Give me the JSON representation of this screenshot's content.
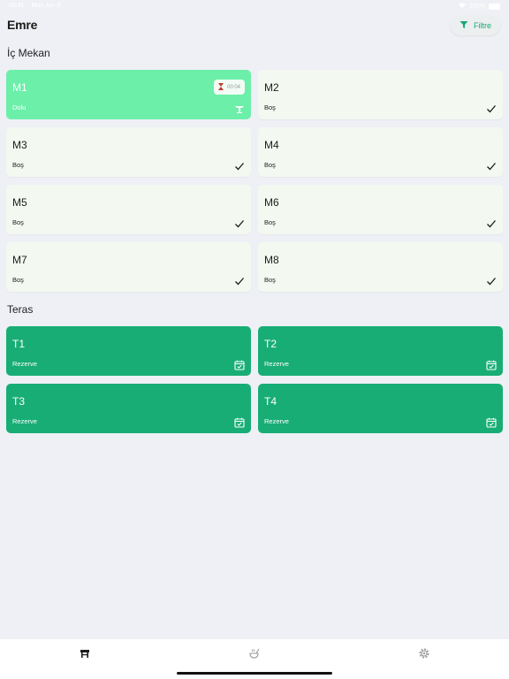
{
  "status_bar": {
    "time": "09:41",
    "date": "Mon Jun 3",
    "battery": "100%"
  },
  "header": {
    "title": "Emre",
    "filter_label": "Filtre"
  },
  "sections": {
    "indoor": {
      "title": "İç Mekan",
      "tables": [
        {
          "name": "M1",
          "status": "Dolu",
          "timer": "00:04"
        },
        {
          "name": "M2",
          "status": "Boş"
        },
        {
          "name": "M3",
          "status": "Boş"
        },
        {
          "name": "M4",
          "status": "Boş"
        },
        {
          "name": "M5",
          "status": "Boş"
        },
        {
          "name": "M6",
          "status": "Boş"
        },
        {
          "name": "M7",
          "status": "Boş"
        },
        {
          "name": "M8",
          "status": "Boş"
        }
      ]
    },
    "terrace": {
      "title": "Teras",
      "tables": [
        {
          "name": "T1",
          "status": "Rezerve"
        },
        {
          "name": "T2",
          "status": "Rezerve"
        },
        {
          "name": "T3",
          "status": "Rezerve"
        },
        {
          "name": "T4",
          "status": "Rezerve"
        }
      ]
    }
  },
  "tabs": [
    {
      "icon": "table-icon",
      "active": true
    },
    {
      "icon": "kitchen-icon",
      "active": false
    },
    {
      "icon": "settings-icon",
      "active": false
    }
  ],
  "colors": {
    "accent": "#18a874",
    "occupied": "#6cefa9",
    "reserved": "#19ad76",
    "empty": "#f3f9f1",
    "background": "#eef0f5"
  }
}
